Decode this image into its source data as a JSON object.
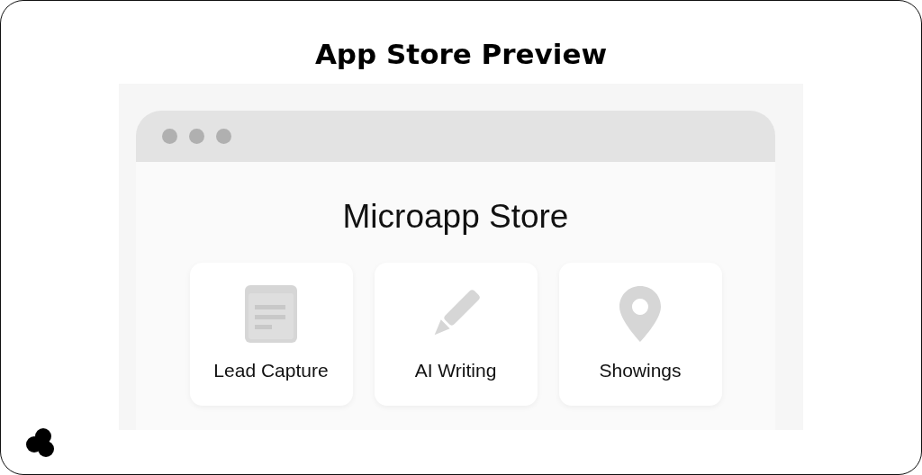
{
  "header": {
    "title": "App Store Preview"
  },
  "preview": {
    "window_title": "Microapp Store",
    "apps": [
      {
        "label": "Lead Capture"
      },
      {
        "label": "AI Writing"
      },
      {
        "label": "Showings"
      }
    ]
  }
}
